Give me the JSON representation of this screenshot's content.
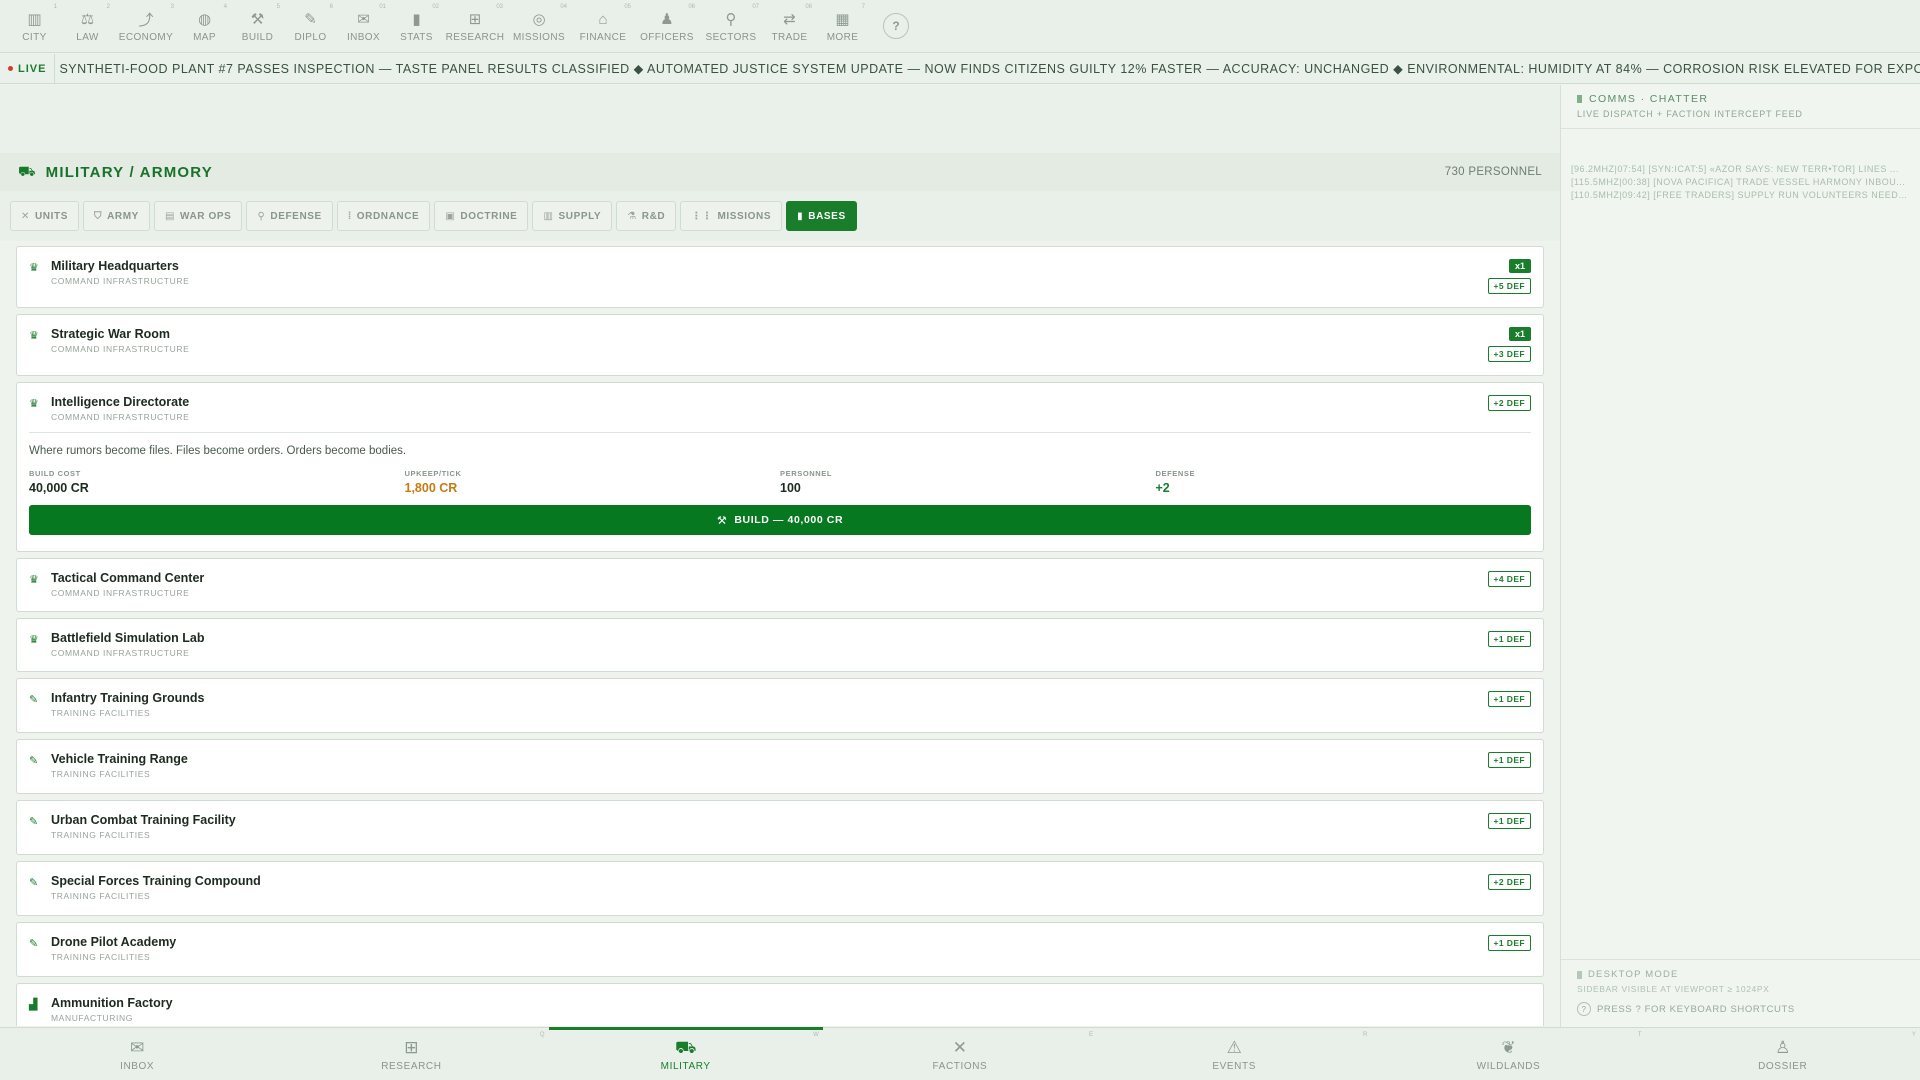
{
  "topnav": {
    "items": [
      {
        "label": "CITY",
        "icon": "city-icon",
        "glyph": "▥",
        "key": "1"
      },
      {
        "label": "LAW",
        "icon": "gavel-icon",
        "glyph": "⚖",
        "key": "2"
      },
      {
        "label": "ECONOMY",
        "icon": "trend-icon",
        "glyph": "⤴",
        "key": "3"
      },
      {
        "label": "MAP",
        "icon": "globe-icon",
        "glyph": "◍",
        "key": "4"
      },
      {
        "label": "BUILD",
        "icon": "tools-icon",
        "glyph": "⚒",
        "key": "5"
      },
      {
        "label": "DIPLO",
        "icon": "handshake-icon",
        "glyph": "✎",
        "key": "6"
      },
      {
        "label": "INBOX",
        "icon": "mail-icon",
        "glyph": "✉",
        "key": "01"
      },
      {
        "label": "STATS",
        "icon": "bar-chart-icon",
        "glyph": "▮",
        "key": "02"
      },
      {
        "label": "RESEARCH",
        "icon": "chip-icon",
        "glyph": "⊞",
        "key": "03"
      },
      {
        "label": "MISSIONS",
        "icon": "compass-icon",
        "glyph": "◎",
        "key": "04"
      },
      {
        "label": "FINANCE",
        "icon": "bank-icon",
        "glyph": "⌂",
        "key": "05"
      },
      {
        "label": "OFFICERS",
        "icon": "person-icon",
        "glyph": "♟",
        "key": "06"
      },
      {
        "label": "SECTORS",
        "icon": "pin-icon",
        "glyph": "⚲",
        "key": "07"
      },
      {
        "label": "TRADE",
        "icon": "swap-icon",
        "glyph": "⇄",
        "key": "08"
      },
      {
        "label": "MORE",
        "icon": "grid-icon",
        "glyph": "▦",
        "key": "7"
      }
    ],
    "help_label": "?"
  },
  "ticker": {
    "live_label": "LIVE",
    "text": "SYNTHETI-FOOD PLANT #7 PASSES INSPECTION — TASTE PANEL RESULTS CLASSIFIED ◆ AUTOMATED JUSTICE SYSTEM UPDATE — NOW FINDS CITIZENS GUILTY 12% FASTER — ACCURACY: UNCHANGED ◆ ENVIRONMENTAL: HUMIDITY AT 84% — CORROSION RISK ELEVATED FOR EXPOSED INFRASTRUCTURE ◆ DEEP WE"
  },
  "header": {
    "title": "MILITARY / ARMORY",
    "personnel": "730 PERSONNEL"
  },
  "tabs": [
    {
      "label": "UNITS",
      "glyph": "✕",
      "icon": "crossed-swords-icon",
      "active": false
    },
    {
      "label": "ARMY",
      "glyph": "⛉",
      "icon": "shield-icon",
      "active": false
    },
    {
      "label": "WAR OPS",
      "glyph": "▤",
      "icon": "map-board-icon",
      "active": false
    },
    {
      "label": "DEFENSE",
      "glyph": "⚲",
      "icon": "pin-icon",
      "active": false
    },
    {
      "label": "ORDNANCE",
      "glyph": "⁞",
      "icon": "ammo-icon",
      "active": false
    },
    {
      "label": "DOCTRINE",
      "glyph": "▣",
      "icon": "book-icon",
      "active": false
    },
    {
      "label": "SUPPLY",
      "glyph": "▥",
      "icon": "crate-icon",
      "active": false
    },
    {
      "label": "R&D",
      "glyph": "⚗",
      "icon": "flask-icon",
      "active": false
    },
    {
      "label": "MISSIONS",
      "glyph": "⋮⋮",
      "icon": "list-icon",
      "active": false
    },
    {
      "label": "BASES",
      "glyph": "▮",
      "icon": "base-icon",
      "active": true
    }
  ],
  "bases": [
    {
      "name": "Military Headquarters",
      "category": "COMMAND INFRASTRUCTURE",
      "glyph": "♛",
      "icon": "crown-icon",
      "count": "x1",
      "def": "+5 DEF"
    },
    {
      "name": "Strategic War Room",
      "category": "COMMAND INFRASTRUCTURE",
      "glyph": "♛",
      "icon": "crown-icon",
      "count": "x1",
      "def": "+3 DEF"
    },
    {
      "name": "Intelligence Directorate",
      "category": "COMMAND INFRASTRUCTURE",
      "glyph": "♛",
      "icon": "crown-icon",
      "def": "+2 DEF",
      "expanded": true,
      "description": "Where rumors become files. Files become orders. Orders become bodies.",
      "stats": [
        {
          "label": "BUILD COST",
          "value": "40,000 CR"
        },
        {
          "label": "UPKEEP/TICK",
          "value": "1,800 CR"
        },
        {
          "label": "PERSONNEL",
          "value": "100"
        },
        {
          "label": "DEFENSE",
          "value": "+2"
        }
      ],
      "build_label": "BUILD — 40,000 CR"
    },
    {
      "name": "Tactical Command Center",
      "category": "COMMAND INFRASTRUCTURE",
      "glyph": "♛",
      "icon": "crown-icon",
      "def": "+4 DEF"
    },
    {
      "name": "Battlefield Simulation Lab",
      "category": "COMMAND INFRASTRUCTURE",
      "glyph": "♛",
      "icon": "crown-icon",
      "def": "+1 DEF"
    },
    {
      "name": "Infantry Training Grounds",
      "category": "TRAINING FACILITIES",
      "glyph": "✎",
      "icon": "rifle-icon",
      "def": "+1 DEF"
    },
    {
      "name": "Vehicle Training Range",
      "category": "TRAINING FACILITIES",
      "glyph": "✎",
      "icon": "rifle-icon",
      "def": "+1 DEF"
    },
    {
      "name": "Urban Combat Training Facility",
      "category": "TRAINING FACILITIES",
      "glyph": "✎",
      "icon": "rifle-icon",
      "def": "+1 DEF"
    },
    {
      "name": "Special Forces Training Compound",
      "category": "TRAINING FACILITIES",
      "glyph": "✎",
      "icon": "rifle-icon",
      "def": "+2 DEF"
    },
    {
      "name": "Drone Pilot Academy",
      "category": "TRAINING FACILITIES",
      "glyph": "✎",
      "icon": "rifle-icon",
      "def": "+1 DEF"
    },
    {
      "name": "Ammunition Factory",
      "category": "MANUFACTURING",
      "glyph": "▟",
      "icon": "factory-icon",
      "def": ""
    }
  ],
  "sidebar": {
    "title": "COMMS · CHATTER",
    "subtitle": "LIVE DISPATCH + FACTION INTERCEPT FEED",
    "chatter": [
      "[96.2MHZ|07:54] [SYN:ICAT:5] «AZOR SAYS: NEW TERR•TOR] LINES ...",
      "[115.5MHZ|00:38] [NOVA PACIFICA] TRADE VESSEL HARMONY INBOU...",
      "[110.5MHZ|09:42] [FREE TRADERS] SUPPLY RUN VOLUNTEERS NEEDE..."
    ],
    "desktop_title": "DESKTOP MODE",
    "desktop_sub": "SIDEBAR VISIBLE AT VIEWPORT ≥ 1024PX",
    "shortcut_text": "PRESS ? FOR KEYBOARD SHORTCUTS"
  },
  "bottomnav": [
    {
      "label": "INBOX",
      "glyph": "✉",
      "icon": "mail-icon",
      "key": "",
      "active": false
    },
    {
      "label": "RESEARCH",
      "glyph": "⊞",
      "icon": "chip-icon",
      "key": "Q",
      "active": false
    },
    {
      "label": "MILITARY",
      "glyph": "⛟",
      "icon": "tank-icon",
      "key": "W",
      "active": true
    },
    {
      "label": "FACTIONS",
      "glyph": "✕",
      "icon": "crossed-swords-icon",
      "key": "E",
      "active": false
    },
    {
      "label": "EVENTS",
      "glyph": "⚠",
      "icon": "warning-icon",
      "key": "R",
      "active": false
    },
    {
      "label": "WILDLANDS",
      "glyph": "❦",
      "icon": "leaf-icon",
      "key": "T",
      "active": false
    },
    {
      "label": "DOSSIER",
      "glyph": "♙",
      "icon": "person-icon",
      "key": "Y",
      "active": false
    }
  ],
  "colors": {
    "accent": "#1a7d2c",
    "upkeep": "#c77b12",
    "background": "#eef3ee"
  }
}
